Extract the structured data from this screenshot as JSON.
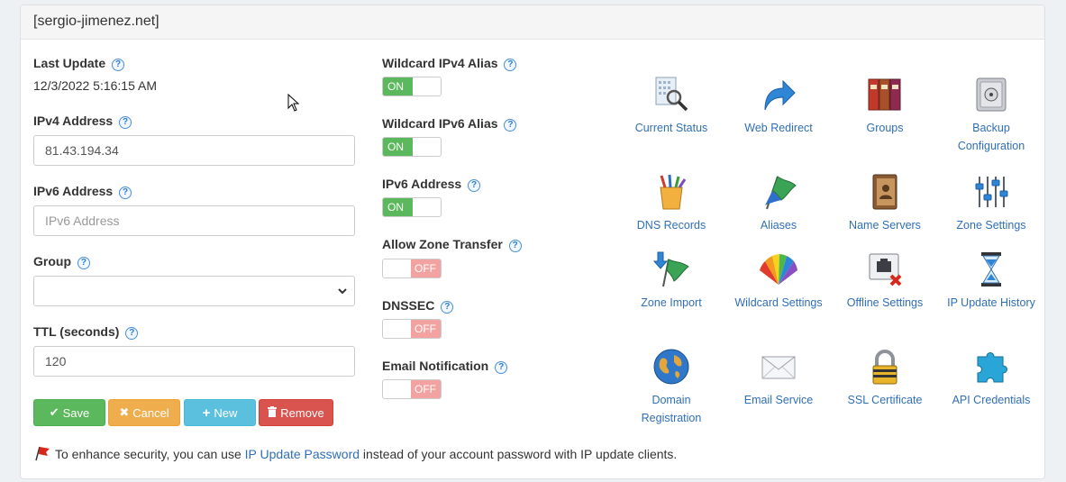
{
  "panel": {
    "title": "[sergio-jimenez.net]"
  },
  "left": {
    "last_update_label": "Last Update",
    "last_update_value": "12/3/2022 5:16:15 AM",
    "ipv4_label": "IPv4 Address",
    "ipv4_value": "81.43.194.34",
    "ipv6_label": "IPv6 Address",
    "ipv6_placeholder": "IPv6 Address",
    "group_label": "Group",
    "group_value": "",
    "ttl_label": "TTL (seconds)",
    "ttl_value": "120"
  },
  "buttons": {
    "save": "Save",
    "cancel": "Cancel",
    "new": "New",
    "remove": "Remove"
  },
  "toggles": [
    {
      "label": "Wildcard IPv4 Alias",
      "state": "ON"
    },
    {
      "label": "Wildcard IPv6 Alias",
      "state": "ON"
    },
    {
      "label": "IPv6 Address",
      "state": "ON"
    },
    {
      "label": "Allow Zone Transfer",
      "state": "OFF"
    },
    {
      "label": "DNSSEC",
      "state": "OFF"
    },
    {
      "label": "Email Notification",
      "state": "OFF"
    }
  ],
  "tiles": [
    {
      "label": "Current Status",
      "icon": "current-status-icon"
    },
    {
      "label": "Web Redirect",
      "icon": "web-redirect-icon"
    },
    {
      "label": "Groups",
      "icon": "groups-icon"
    },
    {
      "label": "Backup Configuration",
      "icon": "backup-configuration-icon"
    },
    {
      "label": "DNS Records",
      "icon": "dns-records-icon"
    },
    {
      "label": "Aliases",
      "icon": "aliases-icon"
    },
    {
      "label": "Name Servers",
      "icon": "name-servers-icon"
    },
    {
      "label": "Zone Settings",
      "icon": "zone-settings-icon"
    },
    {
      "label": "Zone Import",
      "icon": "zone-import-icon"
    },
    {
      "label": "Wildcard Settings",
      "icon": "wildcard-settings-icon"
    },
    {
      "label": "Offline Settings",
      "icon": "offline-settings-icon"
    },
    {
      "label": "IP Update History",
      "icon": "ip-update-history-icon"
    },
    {
      "label": "Domain Registration",
      "icon": "domain-registration-icon"
    },
    {
      "label": "Email Service",
      "icon": "email-service-icon"
    },
    {
      "label": "SSL Certificate",
      "icon": "ssl-certificate-icon"
    },
    {
      "label": "API Credentials",
      "icon": "api-credentials-icon"
    }
  ],
  "footer": {
    "prefix": "To enhance security, you can use ",
    "link": "IP Update Password",
    "suffix": " instead of your account password with IP update clients."
  },
  "help_glyph": "?",
  "colors": {
    "save": "#5cb85c",
    "cancel": "#f0ad4e",
    "new": "#5bc0de",
    "remove": "#d9534f",
    "link": "#2f6fb7",
    "toggle_on": "#5cb85c",
    "toggle_off": "#f2a3a1"
  }
}
